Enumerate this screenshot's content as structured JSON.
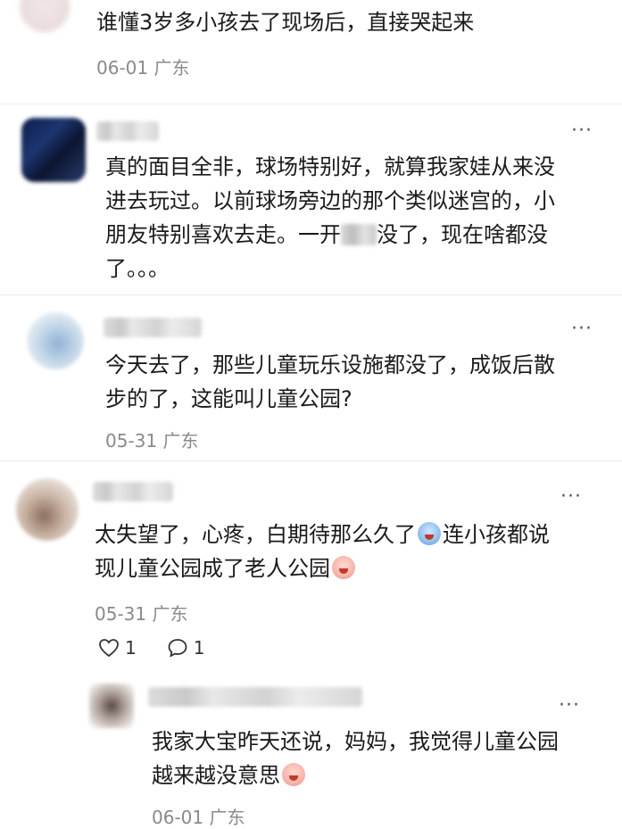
{
  "comments": [
    {
      "text": "谁懂3岁多小孩去了现场后，直接哭起来",
      "date": "06-01",
      "location": "广东"
    },
    {
      "text_lines": [
        "真的面目全非，球场特别好，就算我家娃从来没",
        "进去玩过。以前球场旁边的那个类似迷宫的，小",
        "没了，现在啥都没",
        "了。。。"
      ],
      "line3_prefix": "朋友特别喜欢去走。一开"
    },
    {
      "text_lines": [
        "今天去了，那些儿童玩乐设施都没了，成饭后散",
        "步的了，这能叫儿童公园?"
      ],
      "date": "05-31",
      "location": "广东"
    },
    {
      "text_line1_a": "太失望了，心疼，白期待那么久了",
      "text_line1_b": "连小孩都说",
      "text_line2": "现儿童公园成了老人公园",
      "date": "05-31",
      "location": "广东",
      "likes": "1",
      "replies": "1"
    },
    {
      "text_line1": "我家大宝昨天还说，妈妈，我觉得儿童公园",
      "text_line2": "越来越没意思",
      "date": "06-01",
      "location": "广东"
    }
  ],
  "icons": {
    "more": "more-icon",
    "like": "heart-icon",
    "reply": "comment-bubble-icon",
    "emoji_cry": "crying-face-emoji"
  },
  "more_glyph": "···"
}
